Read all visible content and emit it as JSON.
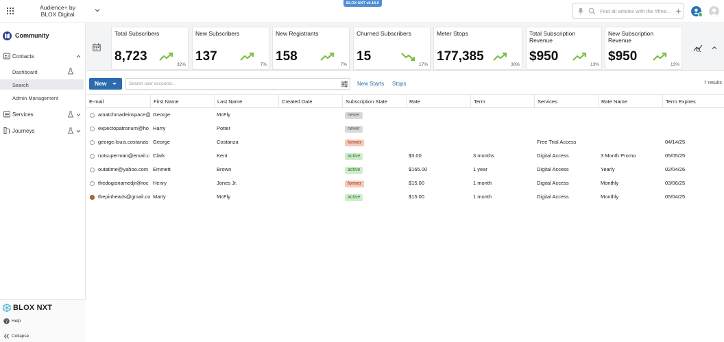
{
  "header": {
    "app_title_line1": "Audience+ by",
    "app_title_line2": "BLOX Digital",
    "version": "BLOX NXT v0.18.0",
    "search_placeholder": "Find all articles with the #free..."
  },
  "sidebar": {
    "brand": "Community",
    "sections": [
      {
        "label": "Contacts",
        "icon": "contacts-icon"
      },
      {
        "label": "Services",
        "icon": "services-icon"
      },
      {
        "label": "Journeys",
        "icon": "journeys-icon"
      }
    ],
    "contacts_items": [
      {
        "label": "Dashboard"
      },
      {
        "label": "Search"
      },
      {
        "label": "Admin Management"
      }
    ],
    "footer_logo": "BLOX NXT",
    "help_label": "Help",
    "collapse_label": "Collapse"
  },
  "kpis": [
    {
      "title": "Total Subscribers",
      "value": "8,723",
      "pct": "32%",
      "trend": "up"
    },
    {
      "title": "New Subscribers",
      "value": "137",
      "pct": "7%",
      "trend": "up"
    },
    {
      "title": "New Registrants",
      "value": "158",
      "pct": "7%",
      "trend": "up"
    },
    {
      "title": "Churned Subscribers",
      "value": "15",
      "pct": "17%",
      "trend": "down"
    },
    {
      "title": "Meter Stops",
      "value": "177,385",
      "pct": "38%",
      "trend": "up"
    },
    {
      "title": "Total Subscription Revenue",
      "value": "$950",
      "pct": "13%",
      "trend": "up"
    },
    {
      "title": "New Subscription Revenue",
      "value": "$950",
      "pct": "13%",
      "trend": "up"
    }
  ],
  "toolbar": {
    "new_label": "New",
    "search_placeholder": "Search user accounts...",
    "new_starts_label": "New Starts",
    "stops_label": "Stops",
    "results": "7 results"
  },
  "table": {
    "columns": [
      "E-mail",
      "First Name",
      "Last Name",
      "Created Date",
      "Subscription State",
      "Rate",
      "Term",
      "Services",
      "Rate Name",
      "Term Expires"
    ],
    "rows": [
      {
        "email": "amatchmadeinspace@",
        "first": "George",
        "last": "McFly",
        "created": "",
        "state": "never",
        "rate": "",
        "term": "",
        "services": "",
        "rate_name": "",
        "expires": "",
        "avatar": "default"
      },
      {
        "email": "expectopatronum@ho",
        "first": "Harry",
        "last": "Potter",
        "created": "",
        "state": "never",
        "rate": "",
        "term": "",
        "services": "",
        "rate_name": "",
        "expires": "",
        "avatar": "default"
      },
      {
        "email": "george.louis.costanza",
        "first": "George",
        "last": "Costanza",
        "created": "",
        "state": "former",
        "rate": "",
        "term": "",
        "services": "Free Trial Access",
        "rate_name": "",
        "expires": "04/14/25",
        "avatar": "default"
      },
      {
        "email": "notsuperman@email.c",
        "first": "Clark",
        "last": "Kent",
        "created": "",
        "state": "active",
        "rate": "$3.00",
        "term": "3 months",
        "services": "Digital Access",
        "rate_name": "3 Month Promo",
        "expires": "05/05/25",
        "avatar": "default"
      },
      {
        "email": "outatime@yahoo.com",
        "first": "Emmett",
        "last": "Brown",
        "created": "",
        "state": "active",
        "rate": "$165.00",
        "term": "1 year",
        "services": "Digital Access",
        "rate_name": "Yearly",
        "expires": "02/04/26",
        "avatar": "default"
      },
      {
        "email": "thedogisnamedjr@roc",
        "first": "Henry",
        "last": "Jones Jr.",
        "created": "",
        "state": "former",
        "rate": "$15.00",
        "term": "1 month",
        "services": "Digital Access",
        "rate_name": "Monthly",
        "expires": "03/06/25",
        "avatar": "default"
      },
      {
        "email": "thepinheads@gmail.co",
        "first": "Marty",
        "last": "McFly",
        "created": "",
        "state": "active",
        "rate": "$15.00",
        "term": "1 month",
        "services": "Digital Access",
        "rate_name": "Monthly",
        "expires": "05/04/25",
        "avatar": "photo"
      }
    ]
  },
  "colors": {
    "accent": "#2b6cb0",
    "trend_up": "#7cc142",
    "trend_down": "#7cc142"
  }
}
